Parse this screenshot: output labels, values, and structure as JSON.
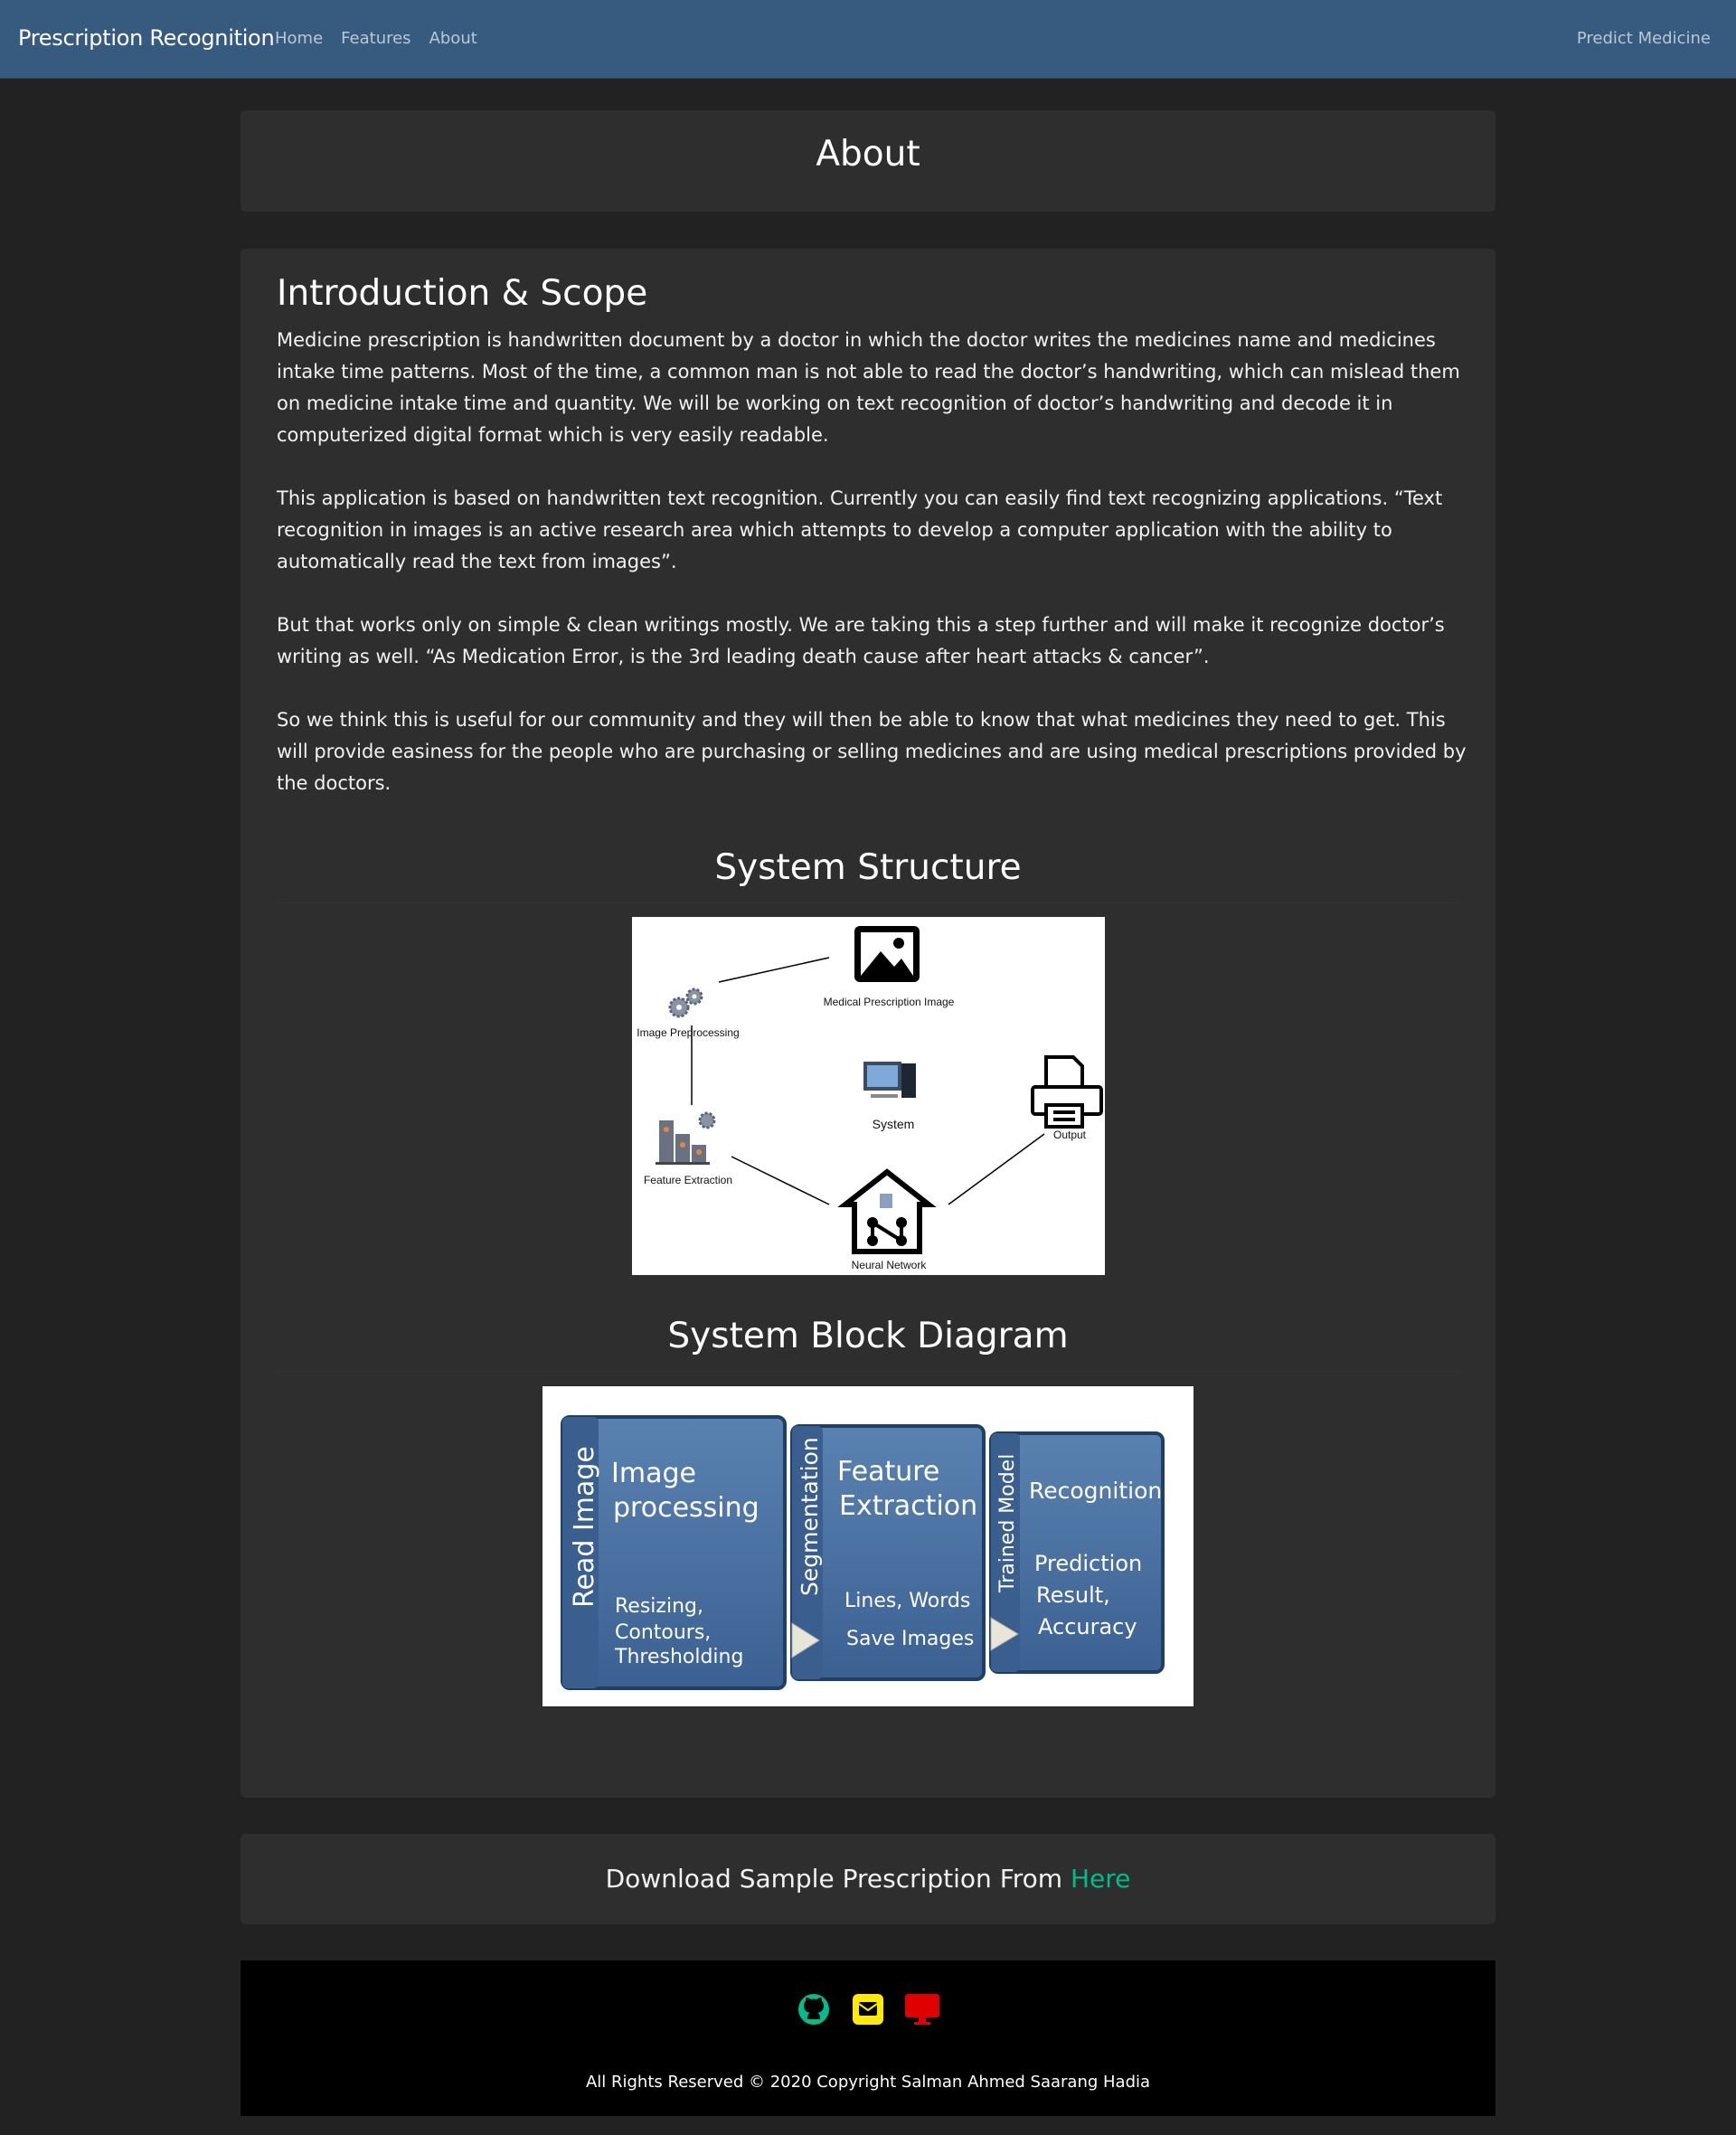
{
  "nav": {
    "brand": "Prescription Recognition",
    "links": [
      "Home",
      "Features",
      "About"
    ],
    "right_link": "Predict Medicine"
  },
  "page_title": "About",
  "intro": {
    "heading": "Introduction & Scope",
    "paragraphs": [
      "Medicine prescription is handwritten document by a doctor in which the doctor writes the medicines name and medicines intake time patterns. Most of the time, a common man is not able to read the doctor’s handwriting, which can mislead them on medicine intake time and quantity. We will be working on text recognition of doctor’s handwriting and decode it in computerized digital format which is very easily readable.",
      "This application is based on handwritten text recognition. Currently you can easily find text recognizing applications. “Text recognition in images is an active research area which attempts to develop a computer application with the ability to automatically read the text from images”.",
      "But that works only on simple & clean writings mostly. We are taking this a step further and will make it recognize doctor’s writing as well. “As Medication Error, is the 3rd leading death cause after heart attacks & cancer”.",
      "So we think this is useful for our community and they will then be able to know that what medicines they need to get. This will provide easiness for the people who are purchasing or selling medicines and are using medical prescriptions provided by the doctors."
    ]
  },
  "structure": {
    "heading": "System Structure",
    "nodes": {
      "image": "Medical Prescription Image",
      "preprocessing": "Image Preprocessing",
      "system": "System",
      "output": "Output",
      "feature": "Feature Extraction",
      "network": "Neural Network"
    }
  },
  "block": {
    "heading": "System Block Diagram",
    "blocks": [
      {
        "side": "Read Image",
        "title1": "Image",
        "title2": "processing",
        "sub1": "Resizing,",
        "sub2": "Contours,",
        "sub3": "Thresholding"
      },
      {
        "side": "Segmentation",
        "title1": "Feature",
        "title2": "Extraction",
        "sub1": "Lines, Words",
        "sub2": "Save Images",
        "sub3": ""
      },
      {
        "side": "Trained Model",
        "title1": "Recognition",
        "title2": "",
        "sub1": "Prediction",
        "sub2": "Result,",
        "sub3": "Accuracy"
      }
    ]
  },
  "download": {
    "text": "Download Sample Prescription From",
    "link": "Here"
  },
  "footer": {
    "copyright": "All Rights Reserved © 2020 Copyright Salman Ahmed Saarang Hadia",
    "icons": [
      "github-icon",
      "email-icon",
      "desktop-icon"
    ]
  },
  "colors": {
    "navbar": "#375a7f",
    "card": "#2e2e2e",
    "link_accent": "#00bc8c",
    "github": "#00bc8c",
    "email": "#ffea00",
    "desktop": "#e00000"
  }
}
